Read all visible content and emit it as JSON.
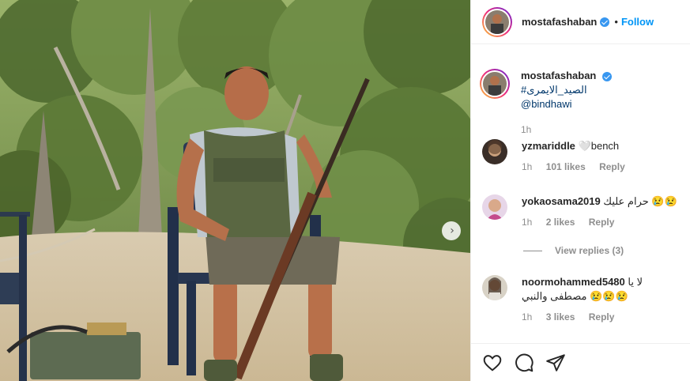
{
  "post": {
    "username": "mostafashaban",
    "follow_label": "Follow",
    "dot": "•",
    "caption_text": "#الصيد_الايمرى",
    "caption_mention": "@bindhawi",
    "caption_time": "1h"
  },
  "comments": [
    {
      "username": "yzmariddle",
      "text": "🤍bench",
      "time": "1h",
      "likes": "101 likes",
      "reply": "Reply"
    },
    {
      "username": "yokaosama2019",
      "text": "حرام عليك 😢😢",
      "time": "1h",
      "likes": "2 likes",
      "reply": "Reply"
    },
    {
      "username": "noormohammed5480",
      "text": "لا يا مصطفى والنبي 😢😢😢",
      "time": "1h",
      "likes": "3 likes",
      "reply": "Reply"
    }
  ],
  "view_replies": "View replies (3)",
  "icons": {
    "like": "heart-icon",
    "comment": "comment-icon",
    "share": "paper-plane-icon",
    "next": "chevron-right-icon",
    "verified": "verified-badge-icon"
  },
  "colors": {
    "link": "#0095f6",
    "verified": "#3897f0",
    "muted": "#8e8e8e",
    "text": "#262626"
  }
}
